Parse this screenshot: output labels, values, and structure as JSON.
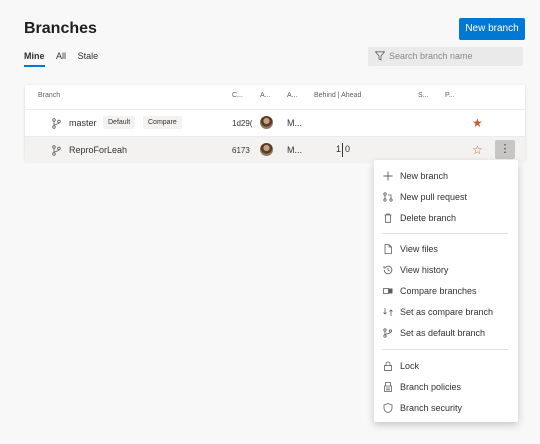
{
  "header": {
    "title": "Branches",
    "new_branch_label": "New branch"
  },
  "tabs": [
    {
      "label": "Mine",
      "active": true
    },
    {
      "label": "All",
      "active": false
    },
    {
      "label": "Stale",
      "active": false
    }
  ],
  "search": {
    "placeholder": "Search branch name"
  },
  "table": {
    "columns": [
      "Branch",
      "C...",
      "A...",
      "A...",
      "Behind | Ahead",
      "S...",
      "P..."
    ],
    "rows": [
      {
        "name": "master",
        "tags": [
          "Default",
          "Compare"
        ],
        "commit": "1d29(",
        "author": "M...",
        "behind": "",
        "ahead": "",
        "favorite": true
      },
      {
        "name": "ReproForLeah",
        "tags": [],
        "commit": "6173",
        "author": "M...",
        "behind": "1",
        "ahead": "0",
        "favorite": false
      }
    ]
  },
  "menu": {
    "items": [
      {
        "label": "New branch",
        "icon": "plus-icon"
      },
      {
        "label": "New pull request",
        "icon": "pull-request-icon"
      },
      {
        "label": "Delete branch",
        "icon": "trash-icon"
      },
      {
        "label": "View files",
        "icon": "file-icon"
      },
      {
        "label": "View history",
        "icon": "history-icon"
      },
      {
        "label": "Compare branches",
        "icon": "compare-icon"
      },
      {
        "label": "Set as compare branch",
        "icon": "compare-set-icon"
      },
      {
        "label": "Set as default branch",
        "icon": "branch-icon"
      },
      {
        "label": "Lock",
        "icon": "lock-icon"
      },
      {
        "label": "Branch policies",
        "icon": "policy-icon"
      },
      {
        "label": "Branch security",
        "icon": "shield-icon"
      }
    ]
  },
  "colors": {
    "accent": "#0078d4",
    "star": "#c45d2a"
  }
}
